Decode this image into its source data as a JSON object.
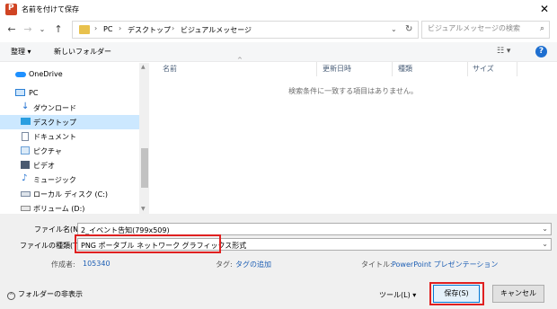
{
  "window": {
    "title": "名前を付けて保存",
    "close_glyph": "✕"
  },
  "nav": {
    "back_glyph": "←",
    "forward_glyph": "→",
    "dropdown_glyph": "⌄",
    "up_glyph": "↑"
  },
  "address": {
    "crumbs": [
      "PC",
      "デスクトップ",
      "ビジュアルメッセージ"
    ],
    "separator": "›",
    "chevron": "⌄",
    "refresh_glyph": "↻"
  },
  "search": {
    "placeholder": "ビジュアルメッセージの検索",
    "icon_glyph": "⌕"
  },
  "toolbar": {
    "organize": "整理 ▾",
    "new_folder": "新しいフォルダー",
    "view_glyph": "☷ ▾",
    "help_glyph": "?"
  },
  "sidebar": {
    "items": [
      {
        "label": "OneDrive",
        "icon": "cloud-icon",
        "color": "#1e90ff"
      },
      {
        "label": "PC",
        "icon": "pc-icon",
        "color": "#2a7fd4"
      },
      {
        "label": "ダウンロード",
        "icon": "download-icon",
        "color": "#1e6fd0"
      },
      {
        "label": "デスクトップ",
        "icon": "desktop-icon",
        "color": "#2a9ee0"
      },
      {
        "label": "ドキュメント",
        "icon": "document-icon",
        "color": "#7a8aa0"
      },
      {
        "label": "ピクチャ",
        "icon": "pictures-icon",
        "color": "#6aa0d8"
      },
      {
        "label": "ビデオ",
        "icon": "video-icon",
        "color": "#4a5a70"
      },
      {
        "label": "ミュージック",
        "icon": "music-icon",
        "color": "#1e6fd0"
      },
      {
        "label": "ローカル ディスク (C:)",
        "icon": "disk-icon",
        "color": "#7a8aa0"
      },
      {
        "label": "ボリューム (D:)",
        "icon": "drive-icon",
        "color": "#8a8a8a"
      }
    ],
    "selected_index": 3
  },
  "columns": [
    "名前",
    "更新日時",
    "種類",
    "サイズ"
  ],
  "empty_message": "検索条件に一致する項目はありません。",
  "form": {
    "filename_label": "ファイル名(N):",
    "filename_value": "2_イベント告知(799x509)",
    "filetype_label": "ファイルの種類(T):",
    "filetype_value": "PNG ポータブル ネットワーク グラフィックス形式"
  },
  "meta": {
    "author_label": "作成者:",
    "author_value": "105340",
    "tags_label": "タグ:",
    "tags_value": "タグの追加",
    "title_label": "タイトル:",
    "title_value": "PowerPoint プレゼンテーション"
  },
  "footer": {
    "hide_folders": "フォルダーの非表示",
    "hide_glyph": "^",
    "tools": "ツール(L) ▾",
    "save": "保存(S)",
    "cancel": "キャンセル"
  },
  "colors": {
    "selected_row": "#cce8ff",
    "highlight_border": "#e02020",
    "link_blue": "#1e5fb4",
    "accent": "#0078d7"
  }
}
